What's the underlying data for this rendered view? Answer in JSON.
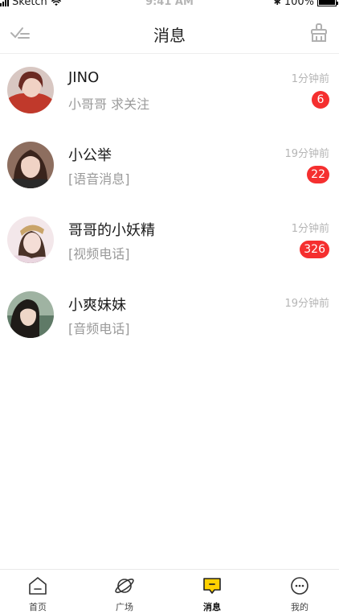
{
  "status_bar": {
    "carrier": "Sketch",
    "time": "9:41 AM",
    "battery": "100%"
  },
  "header": {
    "title": "消息",
    "left_icon": "mark-all-read-icon",
    "right_icon": "clear-broom-icon"
  },
  "messages": [
    {
      "name": "JINO",
      "preview": "小哥哥 求关注",
      "time": "1分钟前",
      "badge": "6",
      "avatar_color": "#c0392b"
    },
    {
      "name": "小公举",
      "preview": "[语音消息]",
      "time": "19分钟前",
      "badge": "22",
      "avatar_color": "#5a3b2e"
    },
    {
      "name": "哥哥的小妖精",
      "preview": "[视频电话]",
      "time": "1分钟前",
      "badge": "326",
      "avatar_color": "#e8cfcf"
    },
    {
      "name": "小爽妹妹",
      "preview": "[音频电话]",
      "time": "19分钟前",
      "badge": null,
      "avatar_color": "#3d4a3a"
    }
  ],
  "tabbar": {
    "tabs": [
      {
        "label": "首页",
        "icon": "home-icon"
      },
      {
        "label": "广场",
        "icon": "planet-icon"
      },
      {
        "label": "消息",
        "icon": "message-icon",
        "active": true
      },
      {
        "label": "我的",
        "icon": "profile-icon"
      }
    ]
  },
  "colors": {
    "accent": "#ffd100",
    "badge": "#f52f2f",
    "muted_text": "#9a9a9a"
  }
}
